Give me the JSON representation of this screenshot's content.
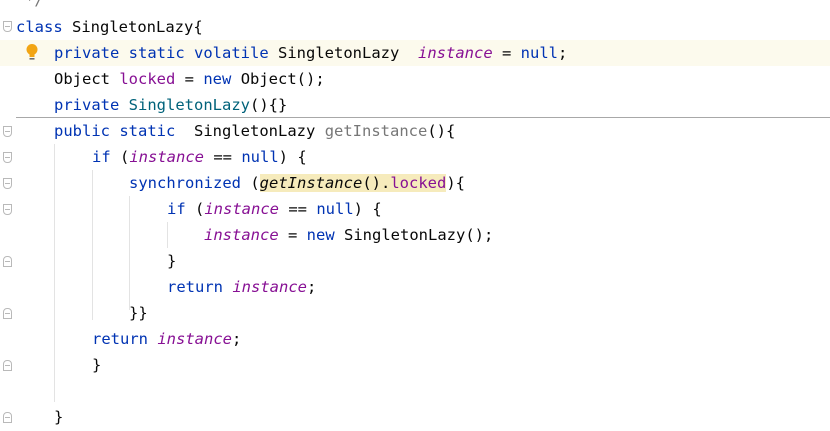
{
  "code": {
    "line0": {
      "comment": "*/"
    },
    "line1": {
      "kw_class": "class",
      "name": "SingletonLazy",
      "brace": "{"
    },
    "line2": {
      "kw_private": "private",
      "kw_static": "static",
      "kw_volatile": "volatile",
      "type": "SingletonLazy",
      "field": "instance",
      "eq": " = ",
      "kw_null": "null",
      "semi": ";"
    },
    "line3": {
      "type": "Object",
      "field": "locked",
      "eq": " = ",
      "kw_new": "new",
      "ctor": "Object();"
    },
    "line4": {
      "kw_private": "private",
      "ctor": "SingletonLazy",
      "rest": "(){}"
    },
    "line5": {
      "kw_public": "public",
      "kw_static": "static",
      "type": "SingletonLazy",
      "method": "getInstance",
      "rest": "(){"
    },
    "line6": {
      "kw_if": "if",
      "open": " (",
      "field": "instance",
      "cmp": " == ",
      "kw_null": "null",
      "close": ") {"
    },
    "line7": {
      "kw_sync": "synchronized",
      "open": " (",
      "call": "getInstance",
      "parens": "()",
      "dot": ".",
      "field": "locked",
      "close": "){"
    },
    "line8": {
      "kw_if": "if",
      "open": " (",
      "field": "instance",
      "cmp": " == ",
      "kw_null": "null",
      "close": ") {"
    },
    "line9": {
      "field": "instance",
      "eq": " = ",
      "kw_new": "new",
      "ctor": "SingletonLazy();"
    },
    "line10": {
      "brace": "}"
    },
    "line11": {
      "kw_return": "return",
      "field": "instance",
      "semi": ";"
    },
    "line12": {
      "braces": "}}"
    },
    "line13": {
      "kw_return": "return",
      "field": "instance",
      "semi": ";"
    },
    "line14": {
      "brace": "}"
    },
    "line16": {
      "brace": "}"
    }
  },
  "icons": {
    "intention": "lightbulb-icon",
    "fold": "fold-marker-icon"
  },
  "colors": {
    "keyword": "#0033b3",
    "field": "#871094",
    "method": "#00627a",
    "comment": "#8c8c8c",
    "current_line": "#fcfaed",
    "highlight": "#f6ebbc"
  }
}
